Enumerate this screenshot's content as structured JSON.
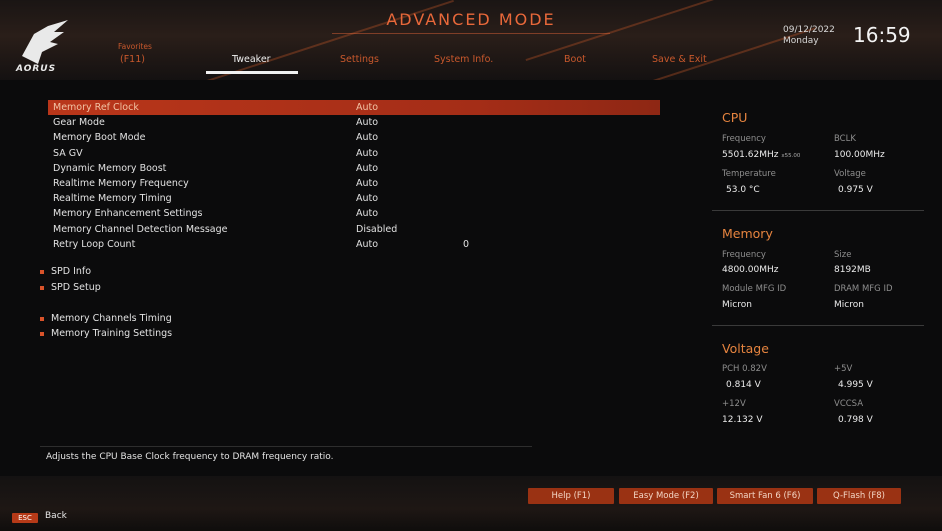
{
  "header": {
    "mode_title": "ADVANCED MODE",
    "logo_text": "AORUS",
    "tabs": [
      {
        "top": "Favorites",
        "label": "(F11)"
      },
      {
        "label": "Tweaker"
      },
      {
        "label": "Settings"
      },
      {
        "label": "System Info."
      },
      {
        "label": "Boot"
      },
      {
        "label": "Save & Exit"
      }
    ],
    "date": "09/12/2022",
    "day": "Monday",
    "time": "16:59"
  },
  "settings": [
    {
      "label": "Memory Ref Clock",
      "value": "Auto"
    },
    {
      "label": "Gear Mode",
      "value": "Auto"
    },
    {
      "label": "Memory Boot Mode",
      "value": "Auto"
    },
    {
      "label": "SA GV",
      "value": "Auto"
    },
    {
      "label": "Dynamic Memory Boost",
      "value": "Auto"
    },
    {
      "label": "Realtime Memory Frequency",
      "value": "Auto"
    },
    {
      "label": "Realtime Memory Timing",
      "value": "Auto"
    },
    {
      "label": "Memory Enhancement Settings",
      "value": "Auto"
    },
    {
      "label": "Memory Channel Detection Message",
      "value": "Disabled"
    },
    {
      "label": "Retry Loop Count",
      "value": "Auto",
      "extra": "0"
    }
  ],
  "submenus": [
    "SPD Info",
    "SPD Setup",
    "Memory Channels Timing",
    "Memory Training Settings"
  ],
  "panel": {
    "cpu": {
      "title": "CPU",
      "freq_label": "Frequency",
      "bclk_label": "BCLK",
      "freq_value": "5501.62MHz",
      "freq_ratio": "x55.00",
      "bclk_value": "100.00MHz",
      "temp_label": "Temperature",
      "volt_label": "Voltage",
      "temp_value": "53.0 °C",
      "volt_value": "0.975 V"
    },
    "memory": {
      "title": "Memory",
      "freq_label": "Frequency",
      "size_label": "Size",
      "freq_value": "4800.00MHz",
      "size_value": "8192MB",
      "module_label": "Module MFG ID",
      "dram_label": "DRAM MFG ID",
      "module_value": "Micron",
      "dram_value": "Micron"
    },
    "voltage": {
      "title": "Voltage",
      "pch_label": "PCH 0.82V",
      "p5v_label": "+5V",
      "pch_value": "0.814 V",
      "p5v_value": "4.995 V",
      "p12v_label": "+12V",
      "vccsa_label": "VCCSA",
      "p12v_value": "12.132 V",
      "vccsa_value": "0.798 V"
    }
  },
  "help_text": "Adjusts the CPU Base Clock frequency to DRAM frequency ratio.",
  "footer": {
    "buttons": [
      "Help (F1)",
      "Easy Mode (F2)",
      "Smart Fan 6 (F6)",
      "Q-Flash (F8)"
    ],
    "esc_key": "ESC",
    "back_label": "Back"
  },
  "colors": {
    "accent": "#e8683a",
    "selected_row": "#b9361a",
    "button": "#9a3213"
  }
}
